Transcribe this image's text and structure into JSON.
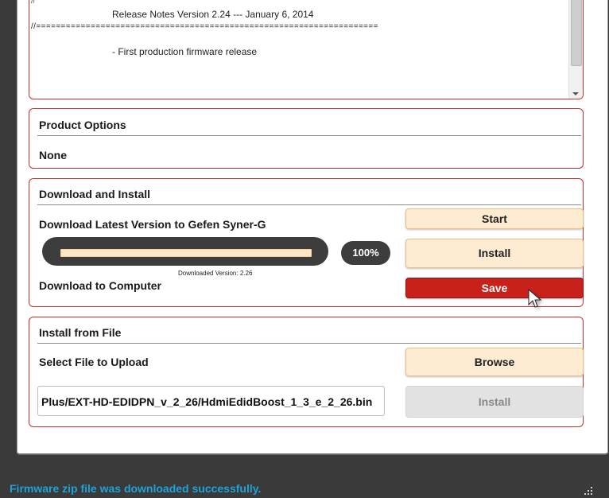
{
  "release_notes": {
    "line0": "//",
    "line1": "Release Notes Version 2.24 --- January 6, 2014",
    "line2": "//=====================================================================",
    "line3": "- First production firmware release"
  },
  "product_options": {
    "title": "Product Options",
    "value": "None"
  },
  "download_install": {
    "title": "Download and Install",
    "download_latest_label": "Download Latest Version to Gefen Syner-G",
    "start_button": "Start",
    "install_button": "Install",
    "progress_percent": "100%",
    "progress_fraction": 1.0,
    "downloaded_version": "Downloaded Version: 2.26",
    "download_to_computer_label": "Download to Computer",
    "save_button": "Save"
  },
  "install_from_file": {
    "title": "Install from File",
    "select_label": "Select File to Upload",
    "browse_button": "Browse",
    "file_path": "Plus/EXT-HD-EDIDPN_v_2_26/HdmiEdidBoost_1_3_e_2_26.bin",
    "install_button": "Install"
  },
  "status_bar": {
    "message": "Firmware zip file was downloaded successfully."
  },
  "colors": {
    "accent_red": "#c3302b",
    "save_red": "#c8211c",
    "button_peach": "#fdebd2",
    "status_blue": "#1fa3d6"
  }
}
